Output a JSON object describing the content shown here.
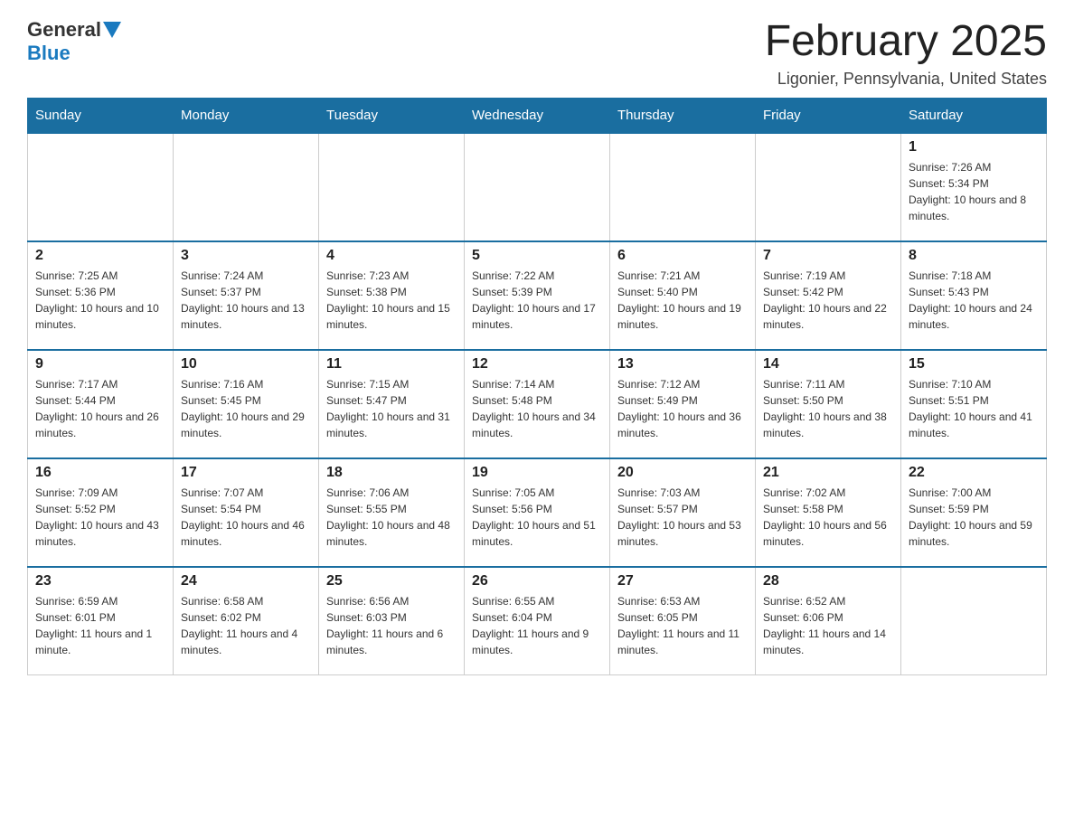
{
  "header": {
    "logo": {
      "general": "General",
      "blue": "Blue"
    },
    "title": "February 2025",
    "subtitle": "Ligonier, Pennsylvania, United States"
  },
  "weekdays": [
    "Sunday",
    "Monday",
    "Tuesday",
    "Wednesday",
    "Thursday",
    "Friday",
    "Saturday"
  ],
  "weeks": [
    [
      {
        "day": "",
        "info": ""
      },
      {
        "day": "",
        "info": ""
      },
      {
        "day": "",
        "info": ""
      },
      {
        "day": "",
        "info": ""
      },
      {
        "day": "",
        "info": ""
      },
      {
        "day": "",
        "info": ""
      },
      {
        "day": "1",
        "info": "Sunrise: 7:26 AM\nSunset: 5:34 PM\nDaylight: 10 hours and 8 minutes."
      }
    ],
    [
      {
        "day": "2",
        "info": "Sunrise: 7:25 AM\nSunset: 5:36 PM\nDaylight: 10 hours and 10 minutes."
      },
      {
        "day": "3",
        "info": "Sunrise: 7:24 AM\nSunset: 5:37 PM\nDaylight: 10 hours and 13 minutes."
      },
      {
        "day": "4",
        "info": "Sunrise: 7:23 AM\nSunset: 5:38 PM\nDaylight: 10 hours and 15 minutes."
      },
      {
        "day": "5",
        "info": "Sunrise: 7:22 AM\nSunset: 5:39 PM\nDaylight: 10 hours and 17 minutes."
      },
      {
        "day": "6",
        "info": "Sunrise: 7:21 AM\nSunset: 5:40 PM\nDaylight: 10 hours and 19 minutes."
      },
      {
        "day": "7",
        "info": "Sunrise: 7:19 AM\nSunset: 5:42 PM\nDaylight: 10 hours and 22 minutes."
      },
      {
        "day": "8",
        "info": "Sunrise: 7:18 AM\nSunset: 5:43 PM\nDaylight: 10 hours and 24 minutes."
      }
    ],
    [
      {
        "day": "9",
        "info": "Sunrise: 7:17 AM\nSunset: 5:44 PM\nDaylight: 10 hours and 26 minutes."
      },
      {
        "day": "10",
        "info": "Sunrise: 7:16 AM\nSunset: 5:45 PM\nDaylight: 10 hours and 29 minutes."
      },
      {
        "day": "11",
        "info": "Sunrise: 7:15 AM\nSunset: 5:47 PM\nDaylight: 10 hours and 31 minutes."
      },
      {
        "day": "12",
        "info": "Sunrise: 7:14 AM\nSunset: 5:48 PM\nDaylight: 10 hours and 34 minutes."
      },
      {
        "day": "13",
        "info": "Sunrise: 7:12 AM\nSunset: 5:49 PM\nDaylight: 10 hours and 36 minutes."
      },
      {
        "day": "14",
        "info": "Sunrise: 7:11 AM\nSunset: 5:50 PM\nDaylight: 10 hours and 38 minutes."
      },
      {
        "day": "15",
        "info": "Sunrise: 7:10 AM\nSunset: 5:51 PM\nDaylight: 10 hours and 41 minutes."
      }
    ],
    [
      {
        "day": "16",
        "info": "Sunrise: 7:09 AM\nSunset: 5:52 PM\nDaylight: 10 hours and 43 minutes."
      },
      {
        "day": "17",
        "info": "Sunrise: 7:07 AM\nSunset: 5:54 PM\nDaylight: 10 hours and 46 minutes."
      },
      {
        "day": "18",
        "info": "Sunrise: 7:06 AM\nSunset: 5:55 PM\nDaylight: 10 hours and 48 minutes."
      },
      {
        "day": "19",
        "info": "Sunrise: 7:05 AM\nSunset: 5:56 PM\nDaylight: 10 hours and 51 minutes."
      },
      {
        "day": "20",
        "info": "Sunrise: 7:03 AM\nSunset: 5:57 PM\nDaylight: 10 hours and 53 minutes."
      },
      {
        "day": "21",
        "info": "Sunrise: 7:02 AM\nSunset: 5:58 PM\nDaylight: 10 hours and 56 minutes."
      },
      {
        "day": "22",
        "info": "Sunrise: 7:00 AM\nSunset: 5:59 PM\nDaylight: 10 hours and 59 minutes."
      }
    ],
    [
      {
        "day": "23",
        "info": "Sunrise: 6:59 AM\nSunset: 6:01 PM\nDaylight: 11 hours and 1 minute."
      },
      {
        "day": "24",
        "info": "Sunrise: 6:58 AM\nSunset: 6:02 PM\nDaylight: 11 hours and 4 minutes."
      },
      {
        "day": "25",
        "info": "Sunrise: 6:56 AM\nSunset: 6:03 PM\nDaylight: 11 hours and 6 minutes."
      },
      {
        "day": "26",
        "info": "Sunrise: 6:55 AM\nSunset: 6:04 PM\nDaylight: 11 hours and 9 minutes."
      },
      {
        "day": "27",
        "info": "Sunrise: 6:53 AM\nSunset: 6:05 PM\nDaylight: 11 hours and 11 minutes."
      },
      {
        "day": "28",
        "info": "Sunrise: 6:52 AM\nSunset: 6:06 PM\nDaylight: 11 hours and 14 minutes."
      },
      {
        "day": "",
        "info": ""
      }
    ]
  ]
}
